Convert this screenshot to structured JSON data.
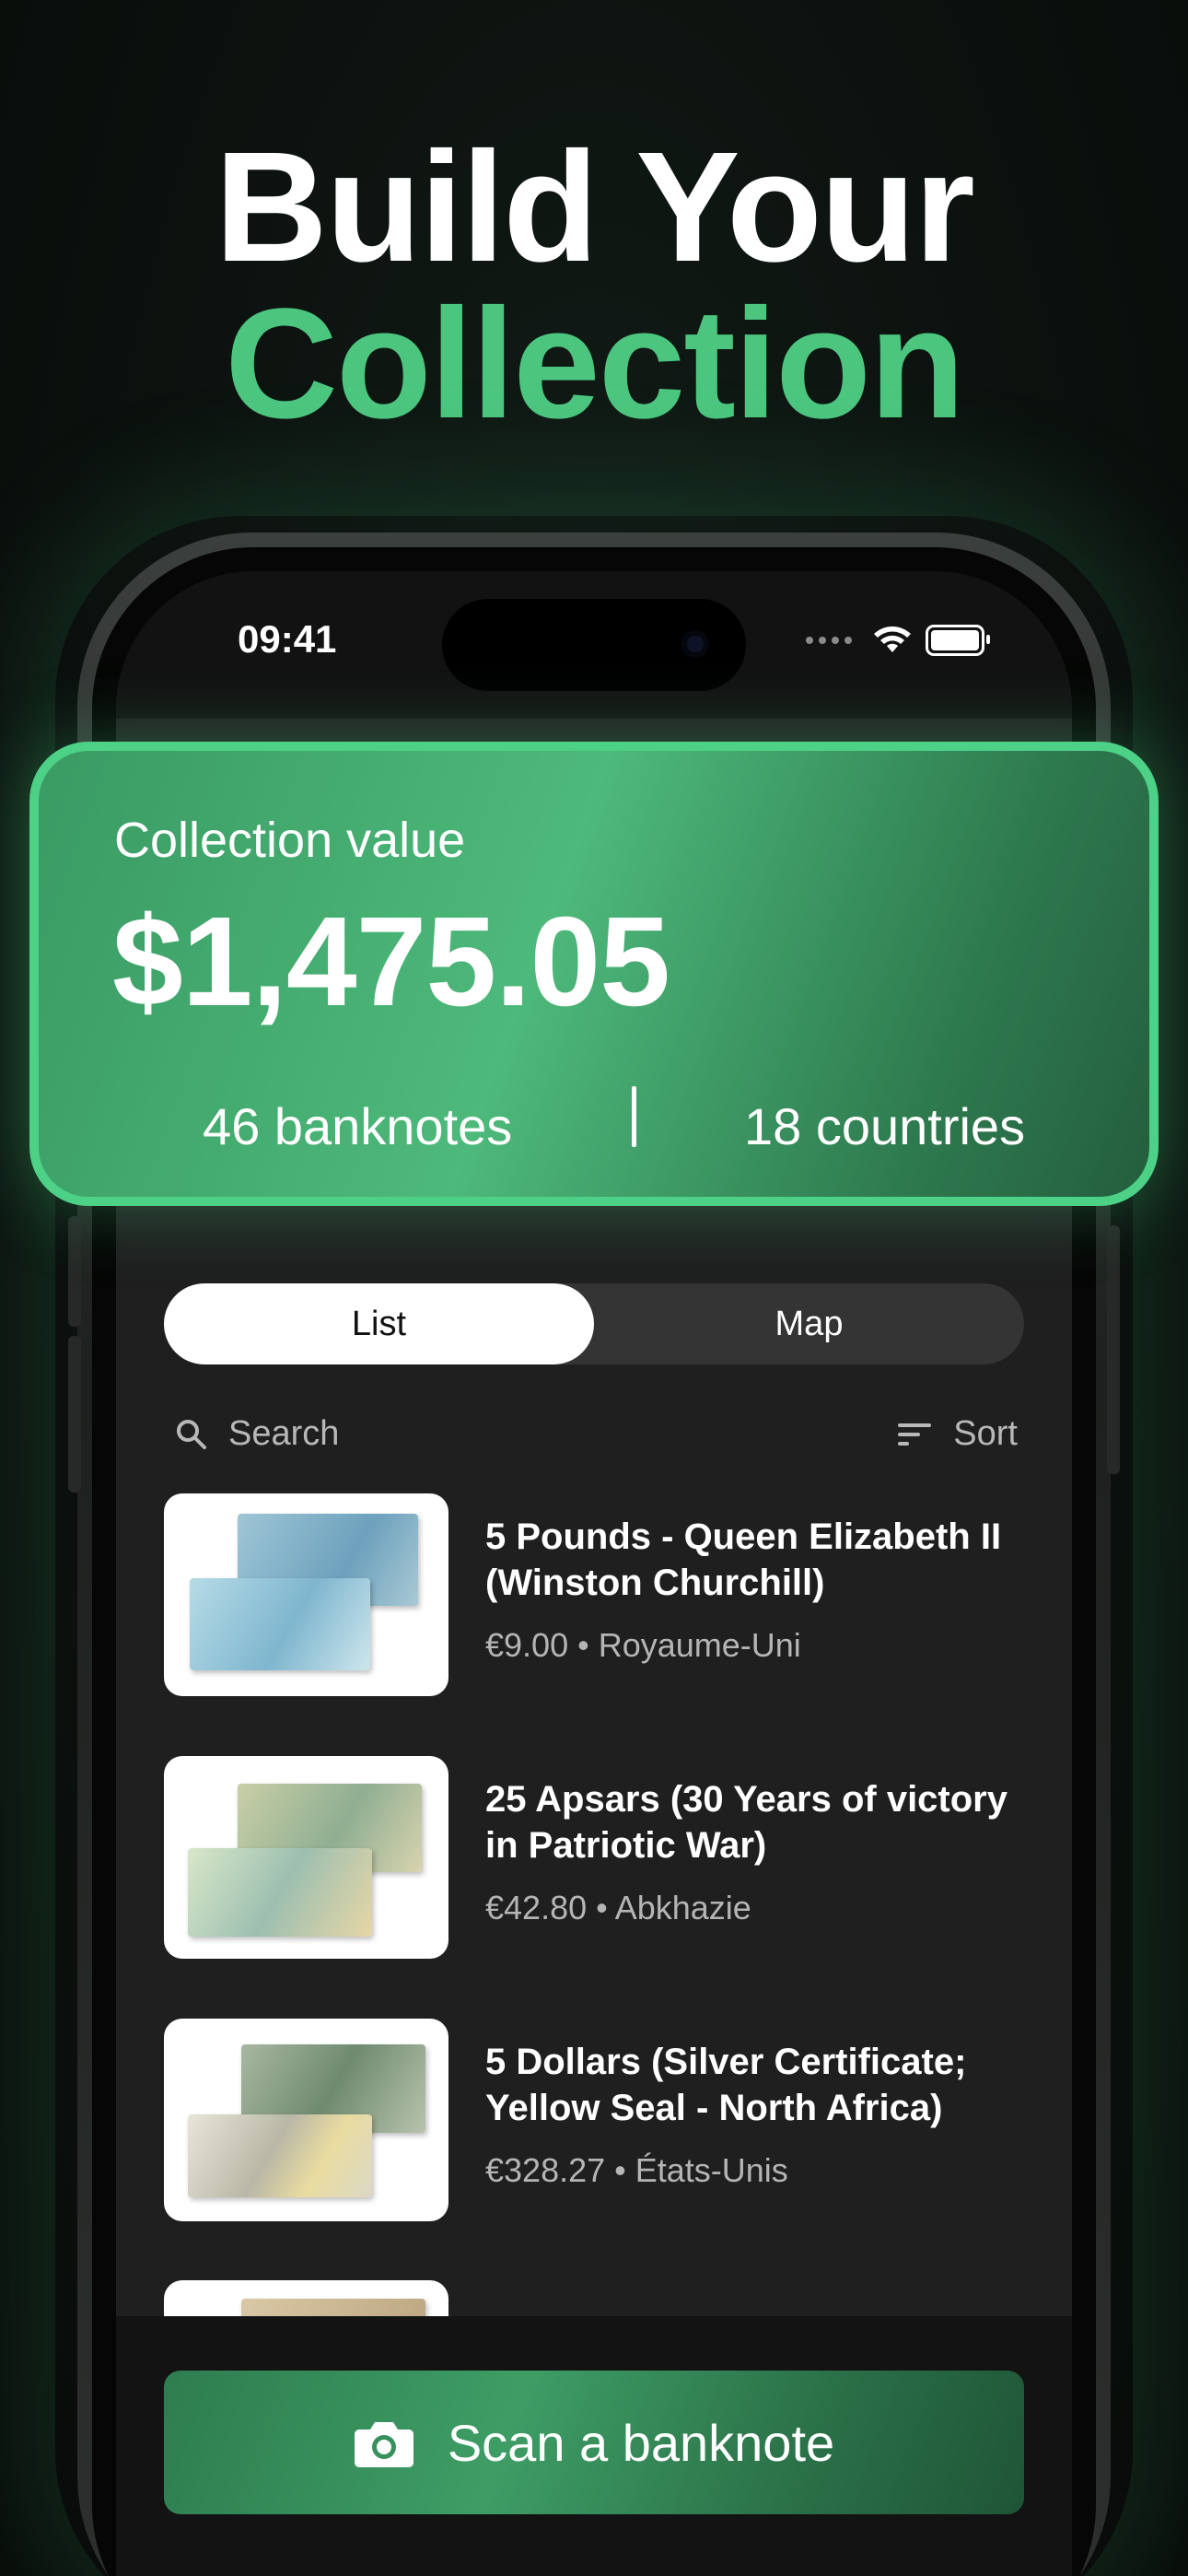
{
  "headline": {
    "line1": "Build Your",
    "line2": "Collection"
  },
  "status_bar": {
    "time": "09:41"
  },
  "collection_card": {
    "label": "Collection value",
    "value": "$1,475.05",
    "banknotes": "46 banknotes",
    "countries": "18 countries"
  },
  "view_toggle": {
    "list": "List",
    "map": "Map",
    "selected": "List"
  },
  "toolbar": {
    "search_placeholder": "Search",
    "sort_label": "Sort"
  },
  "items": [
    {
      "title": "5 Pounds - Queen Elizabeth II (Winston Churchill)",
      "price": "€9.00",
      "country": "Royaume-Uni"
    },
    {
      "title": "25 Apsars (30 Years of victory in Patriotic War)",
      "price": "€42.80",
      "country": "Abkhazie"
    },
    {
      "title": "5 Dollars (Silver Certificate; Yellow Seal - North Africa)",
      "price": "€328.27",
      "country": "États-Unis"
    }
  ],
  "scan_button": {
    "label": "Scan a banknote"
  },
  "colors": {
    "accent": "#4cc67f",
    "card_border": "#4cd186",
    "screen_bg": "#1f1f1f"
  }
}
